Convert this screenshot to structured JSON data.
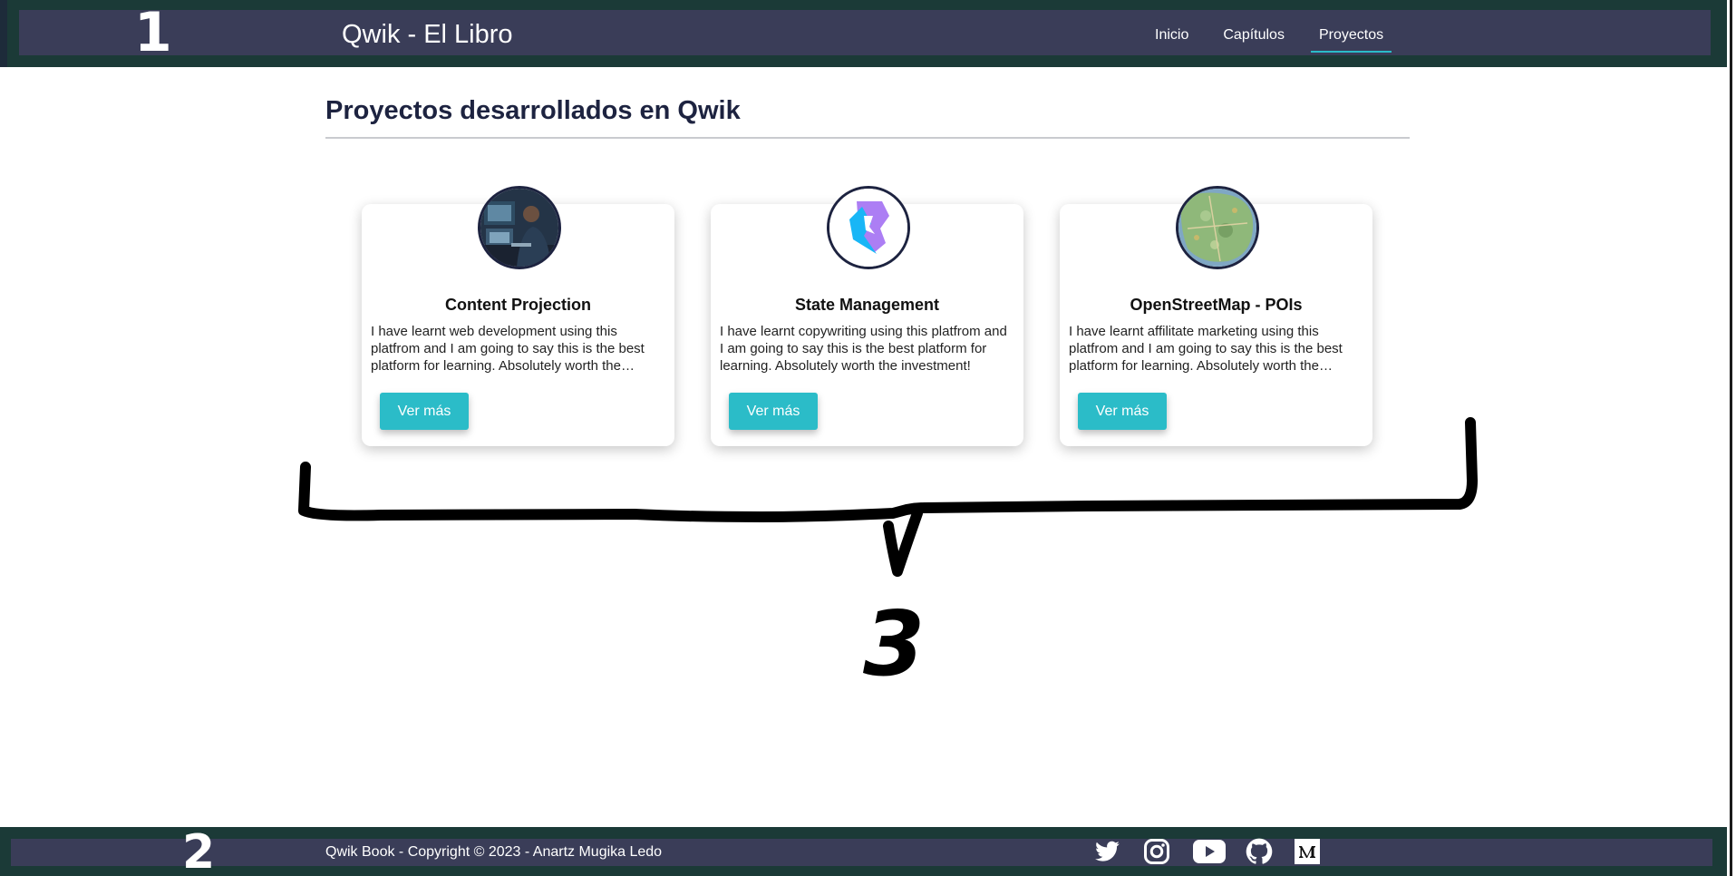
{
  "header": {
    "title": "Qwik - El Libro",
    "nav": [
      {
        "label": "Inicio",
        "active": false
      },
      {
        "label": "Capítulos",
        "active": false
      },
      {
        "label": "Proyectos",
        "active": true
      }
    ]
  },
  "main": {
    "heading": "Proyectos desarrollados en Qwik",
    "cards": [
      {
        "title": "Content Projection",
        "text": "I have learnt web development using this platfrom and I am going to say this is the best platform for learning. Absolutely worth the investment!",
        "button": "Ver más",
        "image": "person-at-computer-image"
      },
      {
        "title": "State Management",
        "text": "I have learnt copywriting using this platfrom and I am going to say this is the best platform for learning. Absolutely worth the investment!",
        "button": "Ver más",
        "image": "qwik-logo-image"
      },
      {
        "title": "OpenStreetMap - POIs",
        "text": "I have learnt affilitate marketing using this platfrom and I am going to say this is the best platform for learning. Absolutely worth the investment!",
        "button": "Ver más",
        "image": "map-image"
      }
    ]
  },
  "footer": {
    "copyright": "Qwik Book - Copyright © 2023 - Anartz Mugika Ledo",
    "social": [
      "twitter-icon",
      "instagram-icon",
      "youtube-icon",
      "github-icon",
      "medium-icon"
    ]
  },
  "annotations": {
    "header_number": "1",
    "footer_number": "2",
    "cards_number": "3"
  },
  "colors": {
    "header_outer": "#1b3a37",
    "header_bar": "#3a3d58",
    "accent": "#2bbcc8",
    "heading": "#1d2340"
  }
}
